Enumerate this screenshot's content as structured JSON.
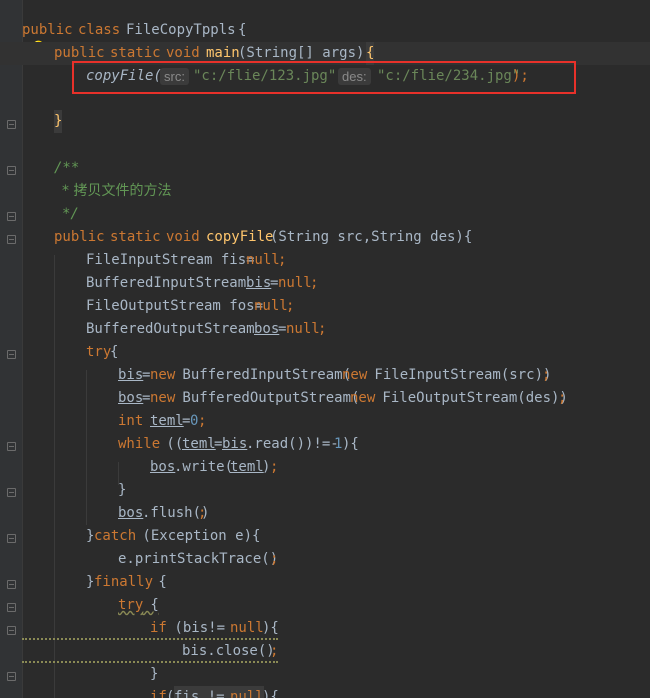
{
  "lines": [
    {
      "tokens": [
        "public",
        "class",
        "FileCopyTppls",
        "{"
      ]
    },
    {
      "tokens": [
        "public",
        "static",
        "void",
        "main",
        "(String[] args)",
        "{"
      ]
    },
    {
      "tokens": [
        "copyFile(",
        "src:",
        "\"c:/flie/123.jpg\",",
        "des:",
        "\"c:/flie/234.jpg\"",
        ");"
      ]
    },
    {
      "tokens": []
    },
    {
      "tokens": [
        "}"
      ]
    },
    {
      "tokens": []
    },
    {
      "tokens": [
        "/**"
      ]
    },
    {
      "tokens": [
        "* 拷贝文件的方法"
      ]
    },
    {
      "tokens": [
        "*/"
      ]
    },
    {
      "tokens": [
        "public",
        "static",
        "void",
        "copyFile",
        "(String src,String des){"
      ]
    },
    {
      "tokens": [
        "FileInputStream fis=",
        "null",
        ";"
      ]
    },
    {
      "tokens": [
        "BufferedInputStream ",
        "bis",
        "=",
        "null",
        ";"
      ]
    },
    {
      "tokens": [
        "FileOutputStream fos=",
        "null",
        ";"
      ]
    },
    {
      "tokens": [
        "BufferedOutputStream ",
        "bos",
        "=",
        "null",
        ";"
      ]
    },
    {
      "tokens": [
        "try",
        "{"
      ]
    },
    {
      "tokens": [
        "bis",
        "=",
        "new",
        " BufferedInputStream(",
        "new",
        " FileInputStream(src))",
        ";"
      ]
    },
    {
      "tokens": [
        "bos",
        "=",
        "new",
        " BufferedOutputStream(",
        "new",
        " FileOutputStream(des))",
        ";"
      ]
    },
    {
      "tokens": [
        "int",
        " ",
        "teml",
        "=",
        "0",
        ";"
      ]
    },
    {
      "tokens": [
        "while",
        " ((",
        "teml",
        "=",
        "bis",
        ".read())!=-",
        "1",
        "){"
      ]
    },
    {
      "tokens": [
        "bos",
        ".write(",
        "teml",
        ")",
        ";"
      ]
    },
    {
      "tokens": [
        "}"
      ]
    },
    {
      "tokens": [
        "bos",
        ".flush()",
        ";"
      ]
    },
    {
      "tokens": [
        "}",
        "catch",
        " (Exception e){"
      ]
    },
    {
      "tokens": [
        "e.printStackTrace()",
        ";"
      ]
    },
    {
      "tokens": [
        "}",
        "finally",
        " {"
      ]
    },
    {
      "tokens": [
        "try",
        " {"
      ]
    },
    {
      "tokens": [
        "if",
        " (bis!= ",
        "null",
        "){"
      ]
    },
    {
      "tokens": [
        "bis.close()",
        ";"
      ]
    },
    {
      "tokens": [
        "}"
      ]
    },
    {
      "tokens": [
        "if",
        "(",
        "fis != ",
        "null",
        "){"
      ]
    }
  ],
  "colors": {
    "background": "#2b2b2b",
    "keyword": "#cc7832",
    "function": "#ffc66d",
    "string": "#6a8759",
    "number": "#6897bb",
    "comment": "#629755",
    "text": "#a9b7c6",
    "highlight_box": "#e8312a"
  },
  "icons": {
    "intention": "lightbulb-icon"
  }
}
